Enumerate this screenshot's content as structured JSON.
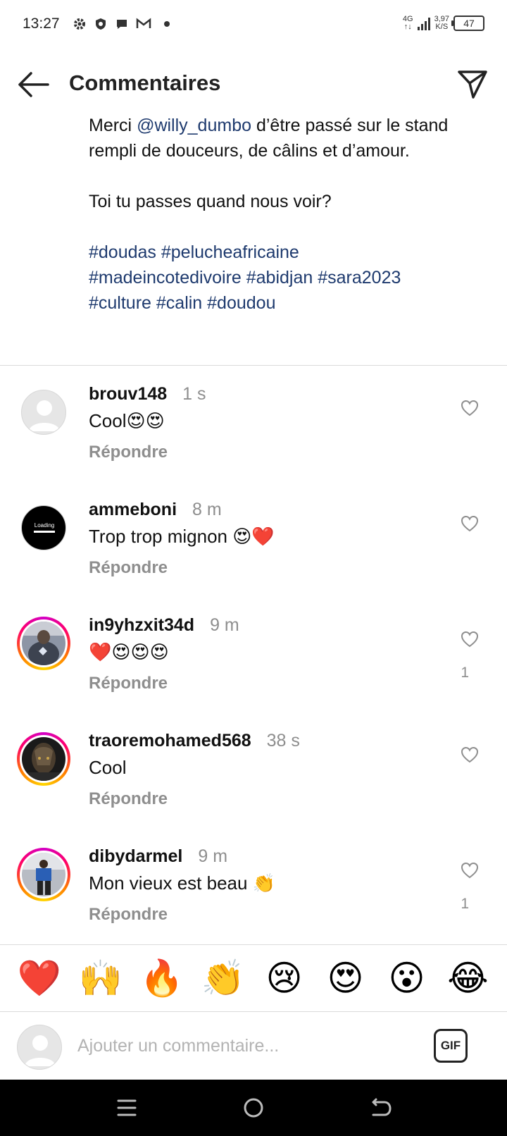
{
  "status_bar": {
    "time": "13:27",
    "network": "4G",
    "network_sub": "↑↓",
    "speed_value": "3,97",
    "speed_unit": "K/S",
    "battery": "47",
    "left_icons": [
      "settings-icon",
      "shield-icon",
      "chat-bubble-icon",
      "gmail-icon"
    ]
  },
  "header": {
    "title": "Commentaires",
    "back_icon": "arrow-left-icon",
    "share_icon": "paper-plane-icon"
  },
  "caption": {
    "line1_prefix": "Merci ",
    "mention": "@willy_dumbo",
    "line1_suffix": " d’être passé sur le stand rempli de douceurs, de câlins et d’amour.",
    "line2": "Toi tu passes quand nous voir?",
    "hashtags_line1": "#doudas #pelucheafricaine",
    "hashtags_line2": "#madeincotedivoire #abidjan #sara2023",
    "hashtags_line3": "#culture #calin #doudou"
  },
  "comments": [
    {
      "username": "brouv148",
      "time": "1 s",
      "text": "Cool😍😍",
      "reply": "Répondre",
      "likes": "",
      "avatar": "default-avatar",
      "ring": false
    },
    {
      "username": "ammeboni",
      "time": "8 m",
      "text": "Trop trop mignon 😍❤️",
      "reply": "Répondre",
      "likes": "",
      "avatar": "loading-avatar",
      "avatar_text": "Loading",
      "ring": false
    },
    {
      "username": "in9yhzxit34d",
      "time": "9 m",
      "text": "❤️😍😍😍",
      "reply": "Répondre",
      "likes": "1",
      "avatar": "photo-avatar",
      "ring": true
    },
    {
      "username": "traoremohamed568",
      "time": "38 s",
      "text": "Cool",
      "reply": "Répondre",
      "likes": "",
      "avatar": "photo-avatar",
      "ring": true
    },
    {
      "username": "dibydarmel",
      "time": "9 m",
      "text": "Mon vieux est beau 👏",
      "reply": "Répondre",
      "likes": "1",
      "avatar": "photo-avatar",
      "ring": true
    }
  ],
  "emoji_bar": [
    "❤️",
    "🙌",
    "🔥",
    "👏",
    "😢",
    "😍",
    "😮",
    "😂"
  ],
  "composer": {
    "placeholder": "Ajouter un commentaire...",
    "gif_label": "GIF"
  },
  "nav_bar": {
    "icons": [
      "menu-icon",
      "home-circle-icon",
      "back-icon"
    ]
  },
  "colors": {
    "hashtag": "#1e3a6e",
    "muted": "#8e8e8e",
    "divider": "#dbdbdb"
  }
}
